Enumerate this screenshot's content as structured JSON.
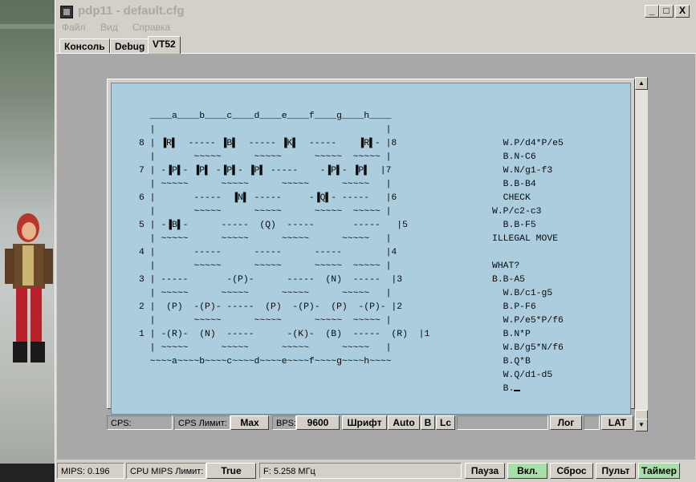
{
  "window": {
    "title": "pdp11 - default.cfg",
    "minimize": "_",
    "maximize": "□",
    "close": "X"
  },
  "menu": [
    "Файл",
    "Вид",
    "Справка"
  ],
  "tabs": [
    {
      "label": "Консоль",
      "active": false
    },
    {
      "label": "Debug",
      "active": false
    },
    {
      "label": "VT52",
      "active": true
    }
  ],
  "terminal": {
    "board_lines": [
      "  ____a____b____c____d____e____f____g____h____",
      "  |                                          |",
      "8 | ▐R▌  ----- ▐B▌  ----- ▐K▌  -----    ▐R▌- |8",
      "  |       ~~~~~      ~~~~~      ~~~~~  ~~~~~ |",
      "7 | -▐P▌- ▐P▌ -▐P▌- ▐P▌ -----    -▐P▌- ▐P▌  |7",
      "  | ~~~~~      ~~~~~      ~~~~~      ~~~~~   |",
      "6 |       -----  ▐N▌ -----     -▐Q▌- -----   |6",
      "  |       ~~~~~      ~~~~~      ~~~~~  ~~~~~ |",
      "5 | -▐B▌-      -----  (Q)  -----       -----   |5",
      "  | ~~~~~      ~~~~~      ~~~~~      ~~~~~   |",
      "4 |       -----      -----      -----        |4",
      "  |       ~~~~~      ~~~~~      ~~~~~  ~~~~~ |",
      "3 | -----       -(P)-      -----  (N)  -----  |3",
      "  | ~~~~~      ~~~~~      ~~~~~      ~~~~~   |",
      "2 |  (P)  -(P)- -----  (P)  -(P)-  (P)  -(P)- |2",
      "  |       ~~~~~      ~~~~~      ~~~~~  ~~~~~ |",
      "1 | -(R)-  (N)  -----      -(K)-  (B)  -----  (R)  |1",
      "  | ~~~~~      ~~~~~      ~~~~~      ~~~~~   |",
      "  ~~~~a~~~~b~~~~c~~~~d~~~~e~~~~f~~~~g~~~~h~~~~"
    ],
    "move_lines": [
      "  W.P/d4*P/e5",
      "  B.N-C6",
      "  W.N/g1-f3",
      "  B.B-B4",
      "  CHECK",
      "W.P/c2-c3",
      "  B.B-F5",
      "ILLEGAL MOVE",
      "",
      "WHAT?",
      "B.B-A5",
      "  W.B/c1-g5",
      "  B.P-F6",
      "  W.P/e5*P/f6",
      "  B.N*P",
      "  W.B/g5*N/f6",
      "  B.Q*B",
      "  W.Q/d1-d5",
      "  B."
    ],
    "status": {
      "cps_label": "CPS:",
      "cps_limit_label": "CPS Лимит:",
      "max_button": "Max",
      "bps_label": "BPS:",
      "bps_value": "9600",
      "font_button": "Шрифт",
      "auto_button": "Auto",
      "b_button": "B",
      "lc_button": "Lc",
      "log_button": "Лог",
      "lat_button": "LAT"
    }
  },
  "statusbar": {
    "mips_label": "MIPS:",
    "mips_value": "0.196",
    "cpu_limit_label": "CPU MIPS Лимит:",
    "cpu_limit_value": "True",
    "freq_text": "F: 5.258 МГц",
    "pause_button": "Пауза",
    "on_button": "Вкл.",
    "reset_button": "Сброс",
    "console_button": "Пульт",
    "timer_button": "Таймер"
  },
  "colors": {
    "screen_bg": "#abcddd",
    "active_green": "#a8dfa8",
    "window_face": "#d4d0c8"
  }
}
